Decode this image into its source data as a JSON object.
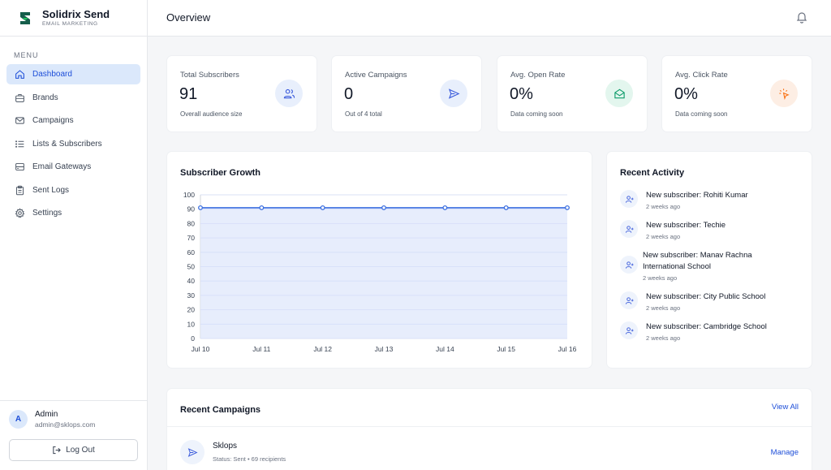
{
  "brand": {
    "name": "Solidrix Send",
    "subtitle": "EMAIL MARKETING"
  },
  "sidebar": {
    "menu_label": "MENU",
    "items": [
      {
        "label": "Dashboard",
        "icon": "home-icon",
        "active": true
      },
      {
        "label": "Brands",
        "icon": "briefcase-icon"
      },
      {
        "label": "Campaigns",
        "icon": "mail-icon"
      },
      {
        "label": "Lists & Subscribers",
        "icon": "list-icon"
      },
      {
        "label": "Email Gateways",
        "icon": "server-icon"
      },
      {
        "label": "Sent Logs",
        "icon": "clipboard-icon"
      },
      {
        "label": "Settings",
        "icon": "gear-icon"
      }
    ]
  },
  "user": {
    "initial": "A",
    "name": "Admin",
    "email": "admin@sklops.com",
    "logout_label": "Log Out"
  },
  "header": {
    "title": "Overview"
  },
  "stats": [
    {
      "label": "Total Subscribers",
      "value": "91",
      "sub": "Overall audience size",
      "icon": "users-icon",
      "color": "#3b5bdb",
      "bg": "#e8effc"
    },
    {
      "label": "Active Campaigns",
      "value": "0",
      "sub": "Out of 4 total",
      "icon": "send-icon",
      "color": "#3b5bdb",
      "bg": "#e8effc"
    },
    {
      "label": "Avg. Open Rate",
      "value": "0%",
      "sub": "Data coming soon",
      "icon": "envelope-open-icon",
      "color": "#0f9d6b",
      "bg": "#e3f6ee"
    },
    {
      "label": "Avg. Click Rate",
      "value": "0%",
      "sub": "Data coming soon",
      "icon": "pointer-click-icon",
      "color": "#f97316",
      "bg": "#fdeee4"
    }
  ],
  "growth": {
    "title": "Subscriber Growth"
  },
  "chart_data": {
    "type": "area",
    "title": "Subscriber Growth",
    "x": [
      "Jul 10",
      "Jul 11",
      "Jul 12",
      "Jul 13",
      "Jul 14",
      "Jul 15",
      "Jul 16"
    ],
    "series": [
      {
        "values": [
          91,
          91,
          91,
          91,
          91,
          91,
          91
        ]
      }
    ],
    "yticks": [
      "0",
      "10",
      "20",
      "30",
      "40",
      "50",
      "60",
      "70",
      "80",
      "90",
      "100"
    ],
    "ylim": [
      0,
      100
    ],
    "grid": true,
    "color": "#3b6fe0"
  },
  "activity": {
    "title": "Recent Activity",
    "items": [
      {
        "title": "New subscriber: Rohiti Kumar",
        "time": "2 weeks ago"
      },
      {
        "title": "New subscriber: Techie",
        "time": "2 weeks ago"
      },
      {
        "title": "New subscriber: Manav Rachna International School",
        "time": "2 weeks ago"
      },
      {
        "title": "New subscriber: City Public School",
        "time": "2 weeks ago"
      },
      {
        "title": "New subscriber: Cambridge School",
        "time": "2 weeks ago"
      }
    ]
  },
  "campaigns": {
    "title": "Recent Campaigns",
    "view_all": "View All",
    "items": [
      {
        "name": "Sklops",
        "status": "Status: Sent • 69 recipients",
        "action": "Manage"
      }
    ]
  }
}
